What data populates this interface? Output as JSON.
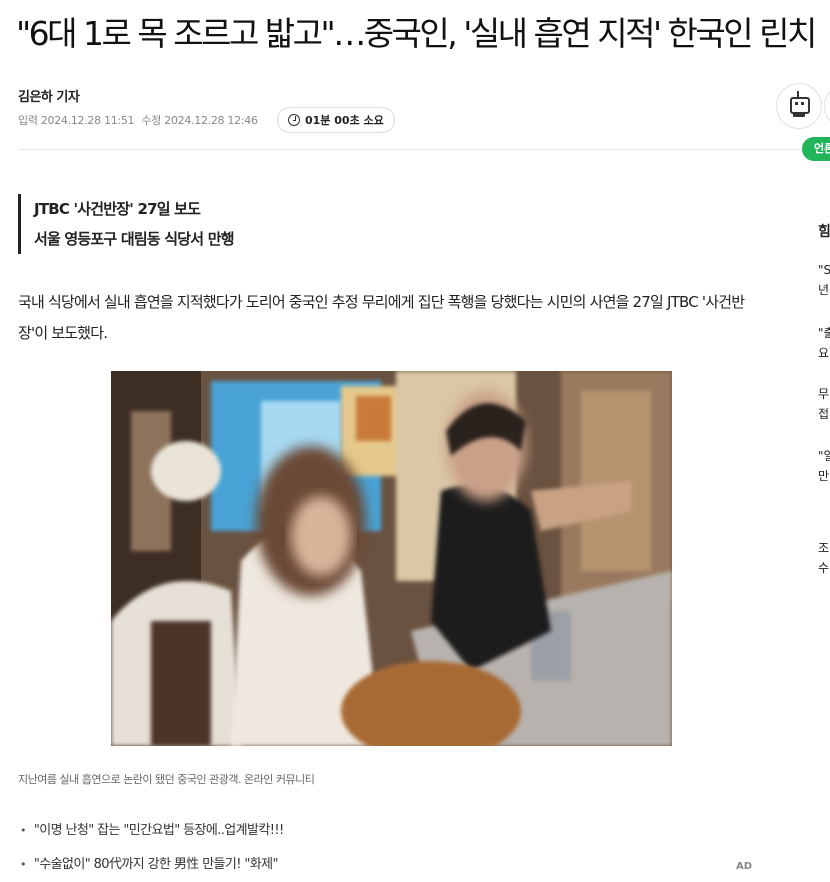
{
  "article": {
    "headline": "\"6대 1로 목 조르고 밟고\"…중국인, '실내 흡연 지적' 한국인 린치",
    "reporter": "김은하 기자",
    "published": "입력 2024.12.28 11:51",
    "modified": "수정 2024.12.28 12:46",
    "read_time": "01분 00초 소요",
    "subheads": [
      "JTBC '사건반장' 27일 보도",
      "서울 영등포구 대림동 식당서 만행"
    ],
    "lead": "국내 식당에서 실내 흡연을 지적했다가 도리어 중국인 추정 무리에게 집단 폭행을 당했다는 시민의 사연을 27일 JTBC '사건반장'이 보도했다.",
    "photo_caption": "지난여름 실내 흡연으로 논란이 됐던 중국인 관광객. 온라인 커뮤니티"
  },
  "toolbar": {
    "robot_icon": "robot-icon",
    "badge_label": "언론"
  },
  "related_links": [
    "\"이명 난청\" 잡는 \"민간요법\" 등장에..업계발칵!!!",
    "\"수술없이\" 80代까지 강한 男性 만들기! \"화제\""
  ],
  "ad_label": "AD",
  "sidebar": {
    "title": "힘",
    "items": [
      {
        "line1": "\"S",
        "line2": "년"
      },
      {
        "line1": "\"출",
        "line2": "요"
      },
      {
        "line1": "무",
        "line2": "접"
      },
      {
        "line1": "\"일",
        "line2": "만"
      },
      {
        "line1": "조",
        "line2": "수"
      }
    ]
  }
}
